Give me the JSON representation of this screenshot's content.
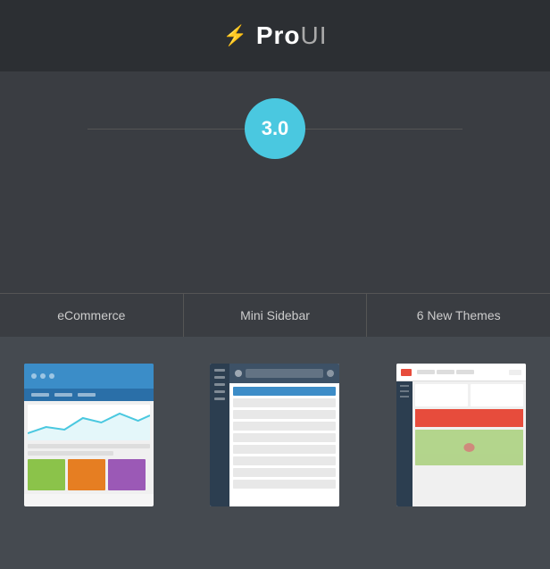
{
  "header": {
    "bolt_icon": "⚡",
    "title_pro": "Pro",
    "title_ui": "UI"
  },
  "version": {
    "number": "3.0"
  },
  "tabs": [
    {
      "label": "eCommerce"
    },
    {
      "label": "Mini Sidebar"
    },
    {
      "label": "6 New Themes"
    }
  ],
  "previews": [
    {
      "alt": "eCommerce preview"
    },
    {
      "alt": "Mini Sidebar preview"
    },
    {
      "alt": "New Themes preview"
    }
  ]
}
